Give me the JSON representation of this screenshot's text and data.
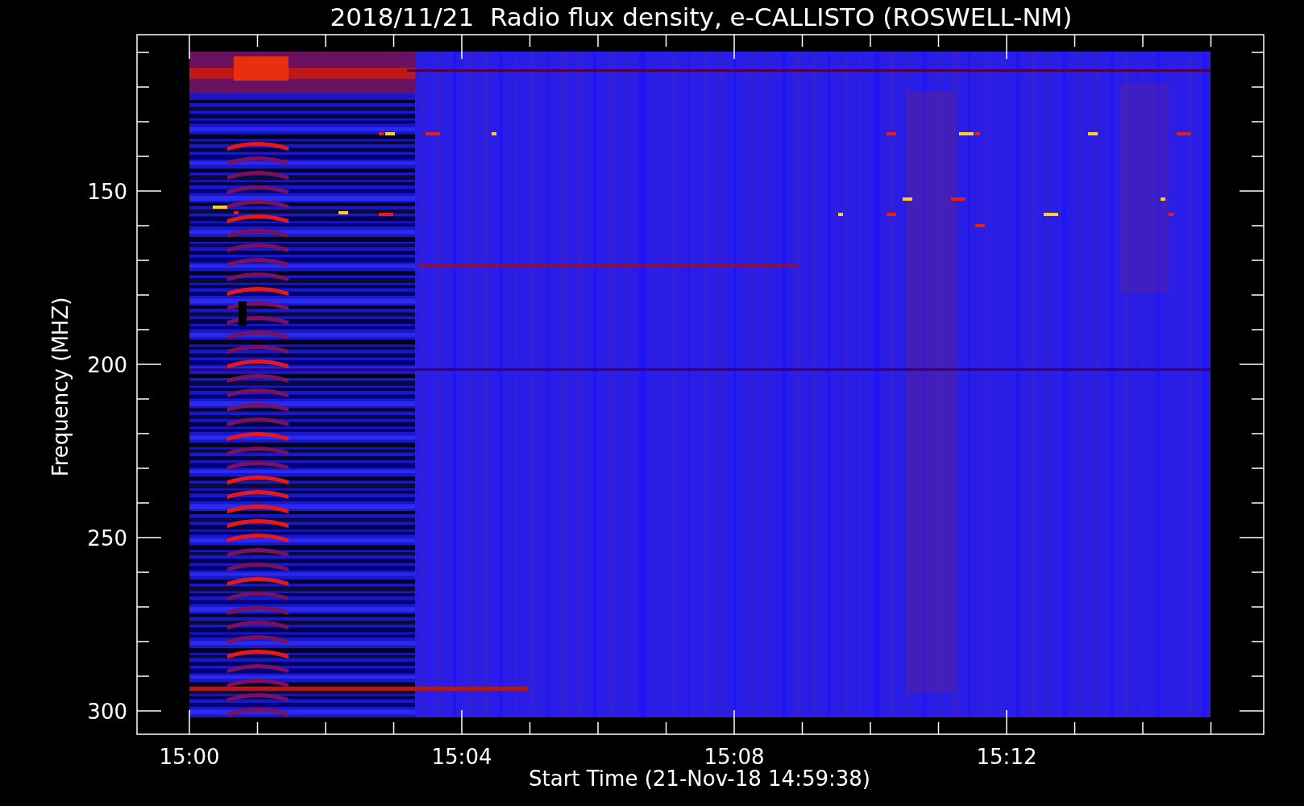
{
  "title": "2018/11/21  Radio flux density, e-CALLISTO (ROSWELL-NM)",
  "y_axis": {
    "label": "Frequency (MHZ)",
    "ticks": [
      "150",
      "200",
      "250",
      "300"
    ]
  },
  "x_axis": {
    "label": "Start Time (21-Nov-18 14:59:38)",
    "ticks": [
      "15:00",
      "15:04",
      "15:08",
      "15:12"
    ]
  }
}
